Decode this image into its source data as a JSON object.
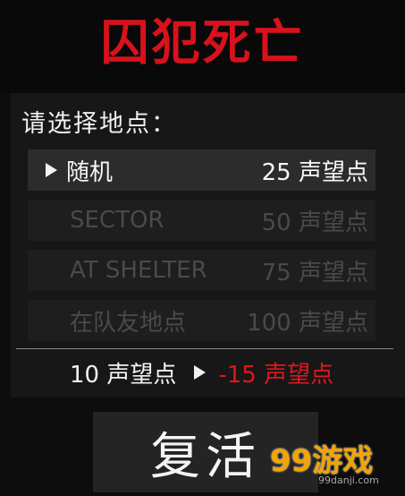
{
  "title": "囚犯死亡",
  "prompt": "请选择地点：",
  "options": [
    {
      "name": "随机",
      "cost": "25 声望点",
      "state": "selected"
    },
    {
      "name": "SECTOR",
      "cost": "50 声望点",
      "state": "disabled"
    },
    {
      "name": "AT SHELTER",
      "cost": "75 声望点",
      "state": "disabled"
    },
    {
      "name": "在队友地点",
      "cost": "100 声望点",
      "state": "disabled"
    }
  ],
  "balance": {
    "current": "10 声望点",
    "after": "-15 声望点"
  },
  "revive_button": "复活",
  "watermark": {
    "logo": "99游戏",
    "url": "99danji.com"
  },
  "colors": {
    "title": "#d8121c",
    "negative": "#e0161e",
    "background": "#0d0d0d"
  }
}
